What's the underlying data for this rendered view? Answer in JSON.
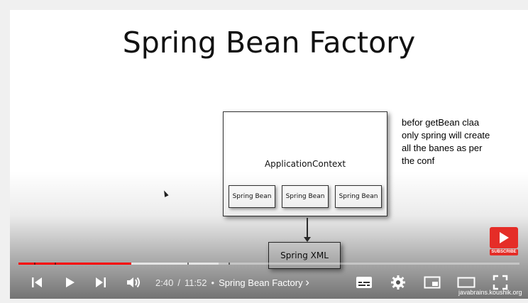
{
  "slide": {
    "title": "Spring Bean Factory",
    "application_context_label": "ApplicationContext",
    "beans": [
      "Spring Bean",
      "Spring Bean",
      "Spring Bean"
    ],
    "xml_label": "Spring XML"
  },
  "annotation_lines": [
    "befor getBean claa",
    "only spring will create",
    "all the banes as per",
    "the conf"
  ],
  "player": {
    "current_time": "2:40",
    "time_separator": "/",
    "duration": "11:52",
    "bullet": "•",
    "chapter_title": "Spring Bean Factory",
    "chevron": "›",
    "played_fraction": 0.225,
    "loaded_fraction": 0.4,
    "accent_color": "#ff0000"
  },
  "subscribe_label": "SUBSCRIBE",
  "watermark": "javabrains.koushik.org"
}
